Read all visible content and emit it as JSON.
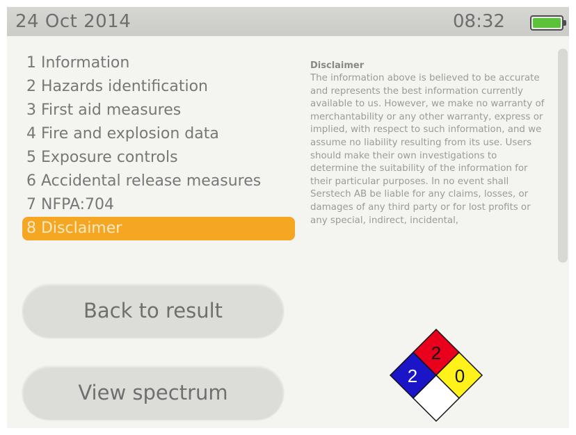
{
  "status_bar": {
    "date": "24 Oct 2014",
    "time": "08:32",
    "battery_level": 1.0,
    "battery_color": "#5cc23a"
  },
  "menu": {
    "items": [
      {
        "label": "1 Information"
      },
      {
        "label": "2 Hazards identification"
      },
      {
        "label": "3 First aid measures"
      },
      {
        "label": "4 Fire and explosion data"
      },
      {
        "label": "5 Exposure controls"
      },
      {
        "label": "6 Accidental release measures"
      },
      {
        "label": "7 NFPA:704"
      },
      {
        "label": "8 Disclaimer"
      }
    ],
    "selected_index": 7,
    "accent_color": "#f5a623"
  },
  "buttons": {
    "back_label": "Back to result",
    "spectrum_label": "View spectrum"
  },
  "content": {
    "title": "Disclaimer",
    "body": "The information above is believed to be accurate and represents the best information currently available to us. However, we make no warranty of merchantability or any other warranty, express or implied, with respect to such information, and we assume no liability resulting from its use. Users should make their own investigations to determine the suitability of the information for their particular purposes. In no event shall Serstech AB be liable for any claims, losses, or damages of any third party or for lost profits or any special, indirect, incidental,"
  },
  "nfpa": {
    "flammability": "2",
    "health": "2",
    "instability": "0",
    "special": "",
    "colors": {
      "flammability": "#e8001c",
      "health": "#1a16c8",
      "instability": "#fff21a",
      "special": "#ffffff"
    }
  },
  "icons": {
    "battery": "battery-full-icon",
    "scrollbar": "vertical-scrollbar"
  }
}
